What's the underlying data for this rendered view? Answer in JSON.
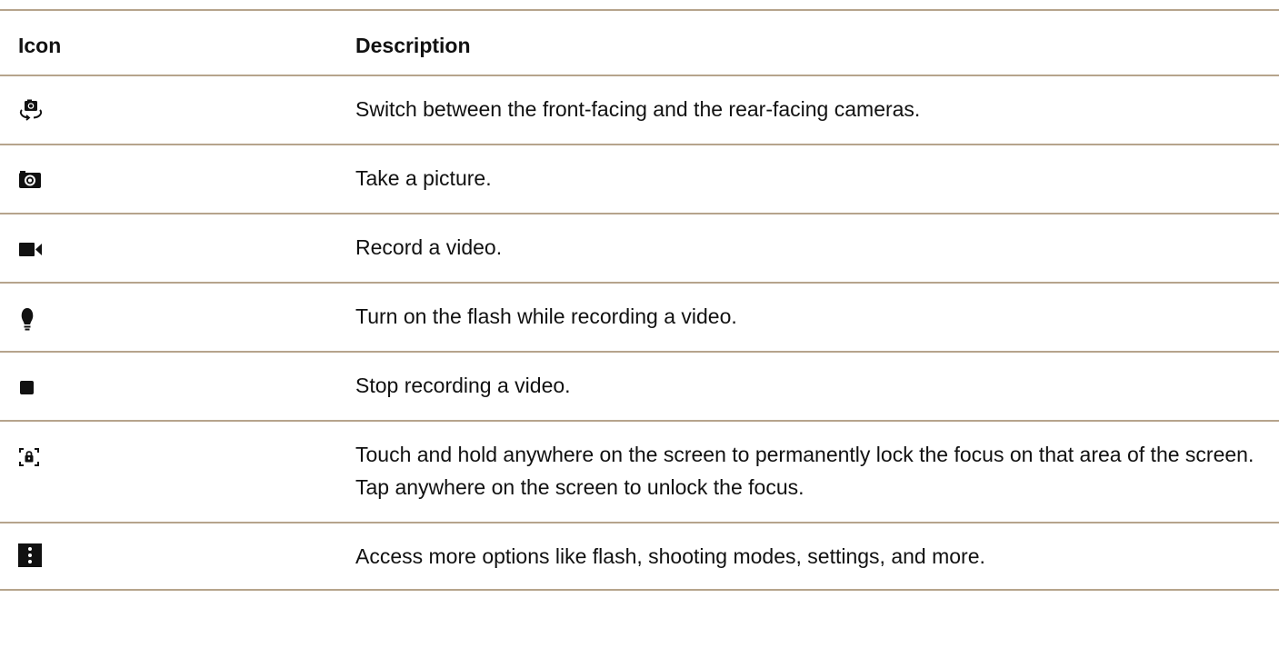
{
  "table": {
    "headers": {
      "icon": "Icon",
      "description": "Description"
    },
    "rows": [
      {
        "icon": "switch-camera-icon",
        "description": "Switch between the front-facing and the rear-facing cameras."
      },
      {
        "icon": "camera-icon",
        "description": "Take a picture."
      },
      {
        "icon": "video-camera-icon",
        "description": "Record a video."
      },
      {
        "icon": "lightbulb-icon",
        "description": "Turn on the flash while recording a video."
      },
      {
        "icon": "stop-icon",
        "description": "Stop recording a video."
      },
      {
        "icon": "focus-lock-icon",
        "description": "Touch and hold anywhere on the screen to permanently lock the focus on that area of the screen. Tap anywhere on the screen to unlock the focus."
      },
      {
        "icon": "more-options-icon",
        "description": "Access more options like flash, shooting modes, settings, and more."
      }
    ]
  },
  "colors": {
    "rule": "#b6a48c",
    "text": "#111111",
    "background": "#ffffff"
  }
}
